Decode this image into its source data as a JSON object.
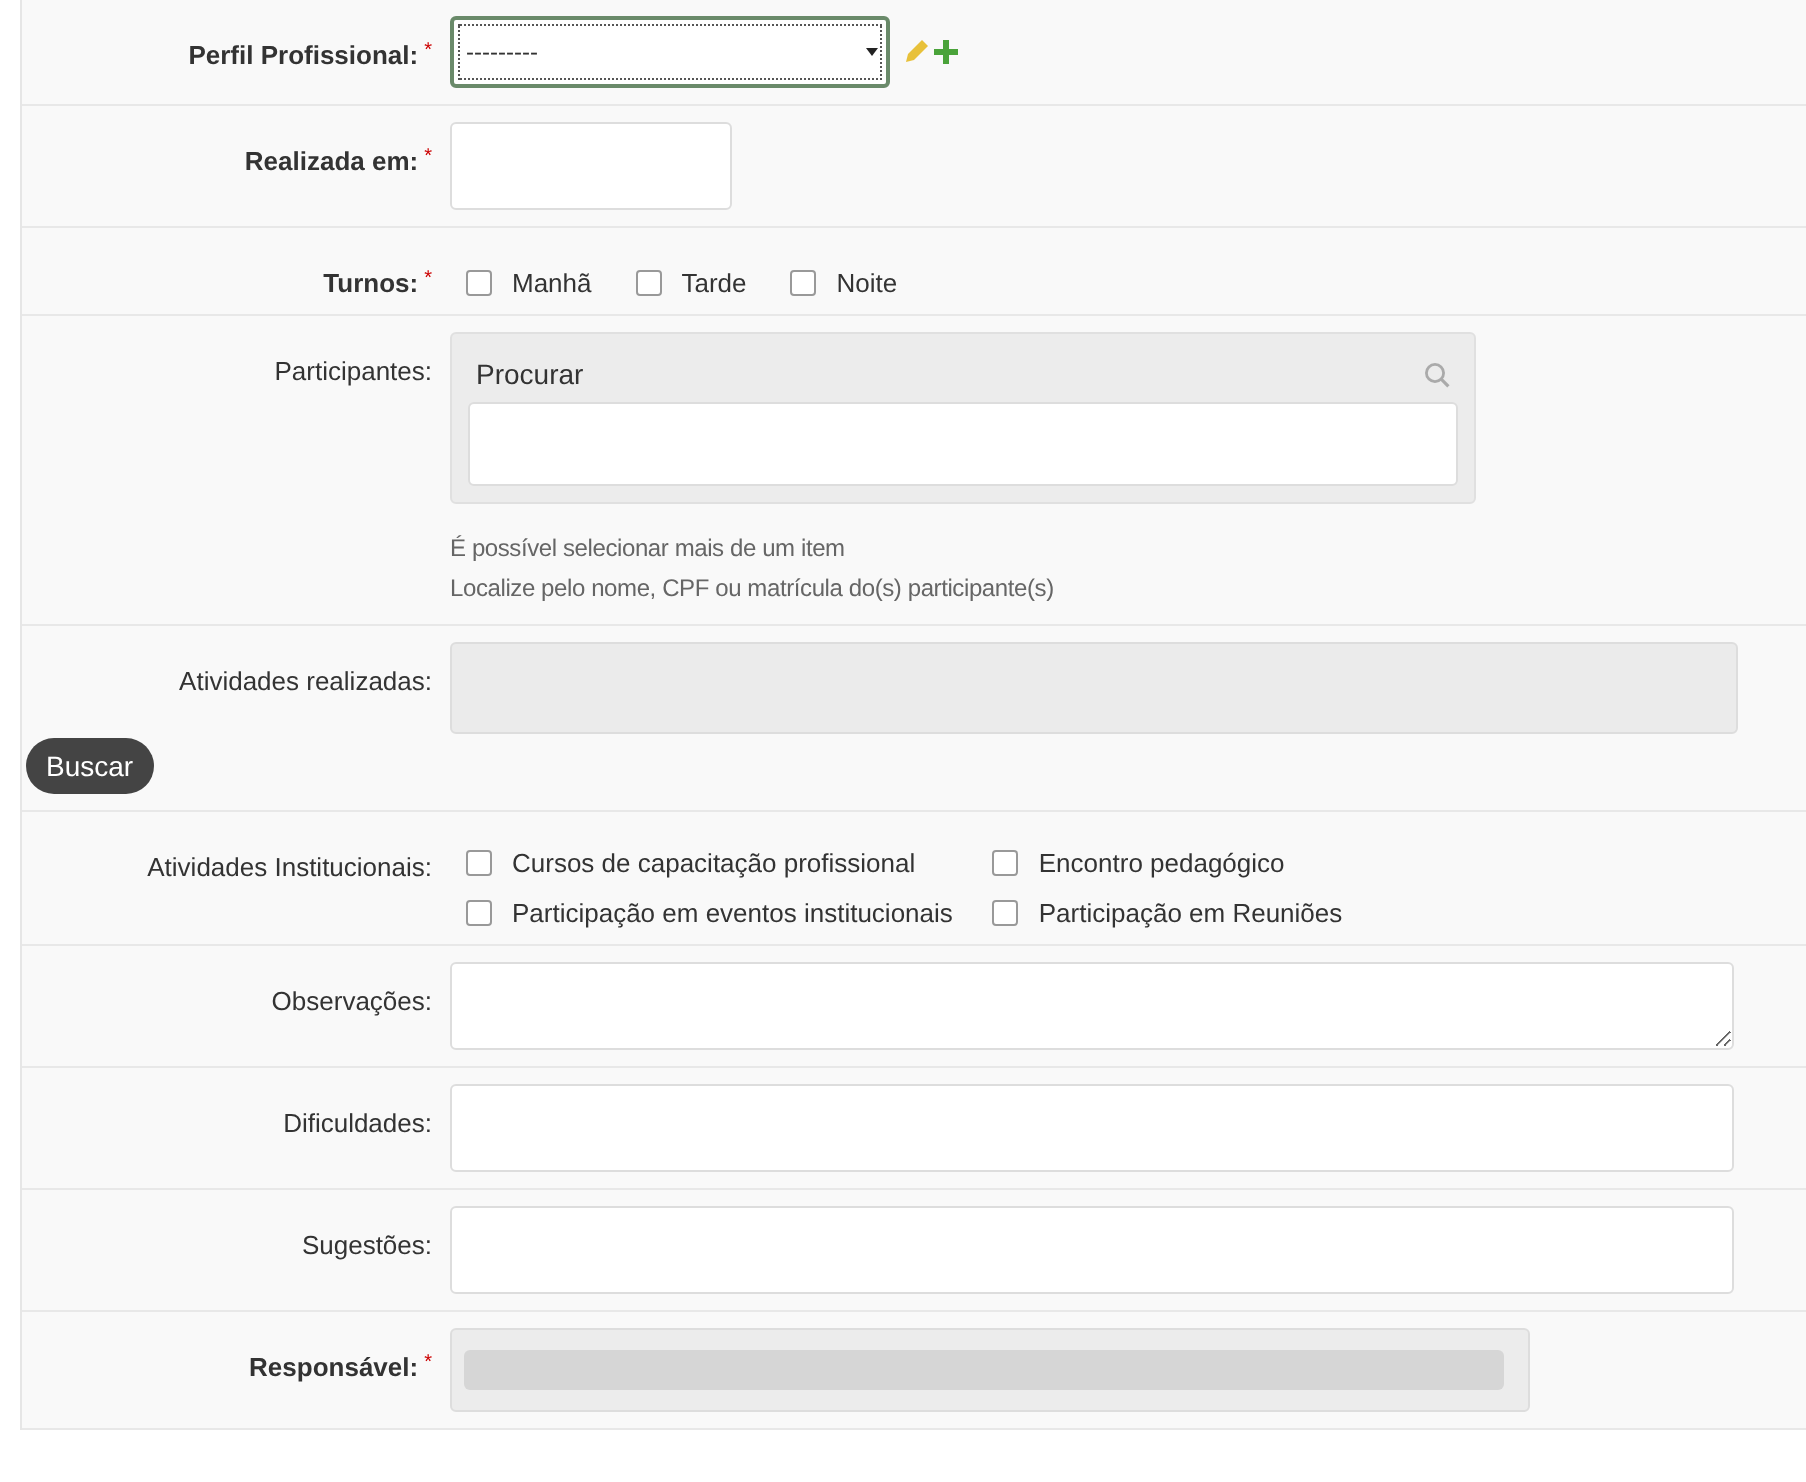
{
  "fields": [
    {
      "kind": "select",
      "label": "Perfil Profissional:",
      "bold": true,
      "required": true,
      "required_mark": "*",
      "value": "---------"
    },
    {
      "kind": "date",
      "label": "Realizada em:",
      "bold": true,
      "required": true,
      "required_mark": "*"
    },
    {
      "kind": "checks",
      "label": "Turnos:",
      "bold": true,
      "required": true,
      "required_mark": "*",
      "options": [
        {
          "label": "Manhã",
          "checked": false
        },
        {
          "label": "Tarde",
          "checked": false
        },
        {
          "label": "Noite",
          "checked": false
        }
      ]
    },
    {
      "kind": "search",
      "label": "Participantes:",
      "bold": false,
      "required": false,
      "placeholder": "Procurar",
      "help": [
        "É possível selecionar mais de um item",
        "Localize pelo nome, CPF ou matrícula do(s) participante(s)"
      ]
    },
    {
      "kind": "readonly",
      "label": "Atividades realizadas:",
      "bold": false,
      "required": false,
      "button": "Buscar"
    },
    {
      "kind": "checks",
      "label": "Atividades Institucionais:",
      "bold": false,
      "required": false,
      "options": [
        {
          "label": "Cursos de capacitação profissional",
          "checked": false
        },
        {
          "label": "Encontro pedagógico",
          "checked": false
        },
        {
          "label": "Participação em eventos institucionais",
          "checked": false
        },
        {
          "label": "Participação em Reuniões",
          "checked": false
        }
      ]
    },
    {
      "kind": "textarea",
      "label": "Observações:",
      "bold": false,
      "required": false
    },
    {
      "kind": "text",
      "label": "Dificuldades:",
      "bold": false,
      "required": false
    },
    {
      "kind": "text",
      "label": "Sugestões:",
      "bold": false,
      "required": false
    },
    {
      "kind": "redacted",
      "label": "Responsável:",
      "bold": true,
      "required": true,
      "required_mark": "*"
    }
  ]
}
